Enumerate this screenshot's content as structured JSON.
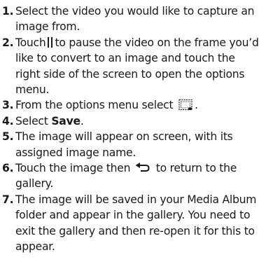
{
  "steps": [
    {
      "number": "1.",
      "text": "Select the video you would like to capture an image from."
    },
    {
      "number": "2.",
      "before": "Touch",
      "icon": "pause-icon",
      "after": "to pause the video on the frame you’d like to convert to an image and touch the right side of the screen to open the options menu."
    },
    {
      "number": "3.",
      "before": "From the options menu select",
      "icon": "image-capture-icon",
      "after": "."
    },
    {
      "number": "4.",
      "before": "Select",
      "bold": "Save",
      "after": "."
    },
    {
      "number": "5.",
      "text": "The image will appear on screen, with its assigned image name."
    },
    {
      "number": "6.",
      "before": "Touch the image then",
      "icon": "back-arrow-icon",
      "after": "to return to the gallery."
    },
    {
      "number": "7.",
      "text": "The image will be saved in your Media Album folder and appear in the gallery. You need to exit the gallery and then re-open it for this to appear."
    }
  ]
}
